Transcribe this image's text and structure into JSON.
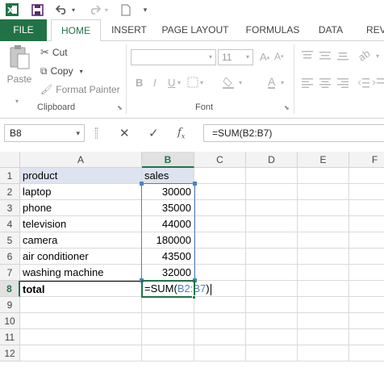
{
  "qat": {
    "icons": [
      "excel-logo-icon",
      "save-icon",
      "undo-icon",
      "redo-icon",
      "new-document-icon",
      "customize-qat-icon"
    ]
  },
  "tabs": [
    "FILE",
    "HOME",
    "INSERT",
    "PAGE LAYOUT",
    "FORMULAS",
    "DATA",
    "REV"
  ],
  "ribbon": {
    "paste_label": "Paste",
    "cut_label": "Cut",
    "copy_label": "Copy",
    "format_painter_label": "Format Painter",
    "clipboard_group": "Clipboard",
    "font_group": "Font",
    "font_size": "11"
  },
  "formula_bar": {
    "name_box": "B8",
    "formula": "=SUM(B2:B7)"
  },
  "sheet": {
    "columns": [
      "A",
      "B",
      "C",
      "D",
      "E",
      "F"
    ],
    "rows": [
      "1",
      "2",
      "3",
      "4",
      "5",
      "6",
      "7",
      "8",
      "9",
      "10",
      "11",
      "12"
    ],
    "header": {
      "a": "product",
      "b": "sales"
    },
    "data": [
      {
        "product": "laptop",
        "sales": "30000"
      },
      {
        "product": "phone",
        "sales": "35000"
      },
      {
        "product": "television",
        "sales": "44000"
      },
      {
        "product": "camera",
        "sales": "180000"
      },
      {
        "product": "air conditioner",
        "sales": "43500"
      },
      {
        "product": "washing machine",
        "sales": "32000"
      }
    ],
    "total_label": "total",
    "total_formula_prefix": "=SUM(",
    "total_formula_ref": "B2:B7",
    "total_formula_suffix": ")"
  },
  "colors": {
    "accent": "#217346",
    "range_highlight": "#4f81bd"
  }
}
